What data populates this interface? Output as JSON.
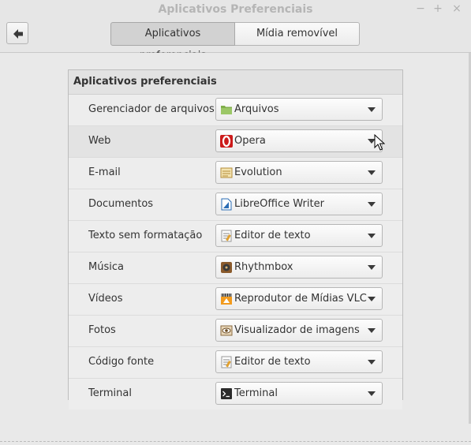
{
  "window": {
    "title": "Aplicativos Preferenciais"
  },
  "headerbar": {
    "tabs": [
      {
        "label": "Aplicativos preferenciais",
        "active": true
      },
      {
        "label": "Mídia removível",
        "active": false
      }
    ]
  },
  "panel": {
    "title": "Aplicativos preferenciais",
    "rows": [
      {
        "label": "Gerenciador de arquivos",
        "value": "Arquivos",
        "icon": "folder-icon"
      },
      {
        "label": "Web",
        "value": "Opera",
        "icon": "opera-icon"
      },
      {
        "label": "E-mail",
        "value": "Evolution",
        "icon": "evolution-mail-icon"
      },
      {
        "label": "Documentos",
        "value": "LibreOffice Writer",
        "icon": "libreoffice-writer-icon"
      },
      {
        "label": "Texto sem formatação",
        "value": "Editor de texto",
        "icon": "text-editor-icon"
      },
      {
        "label": "Música",
        "value": "Rhythmbox",
        "icon": "rhythmbox-icon"
      },
      {
        "label": "Vídeos",
        "value": "Reprodutor de Mídias VLC",
        "icon": "vlc-icon"
      },
      {
        "label": "Fotos",
        "value": "Visualizador de imagens",
        "icon": "image-viewer-icon"
      },
      {
        "label": "Código fonte",
        "value": "Editor de texto",
        "icon": "text-editor-icon"
      },
      {
        "label": "Terminal",
        "value": "Terminal",
        "icon": "terminal-icon"
      }
    ]
  }
}
